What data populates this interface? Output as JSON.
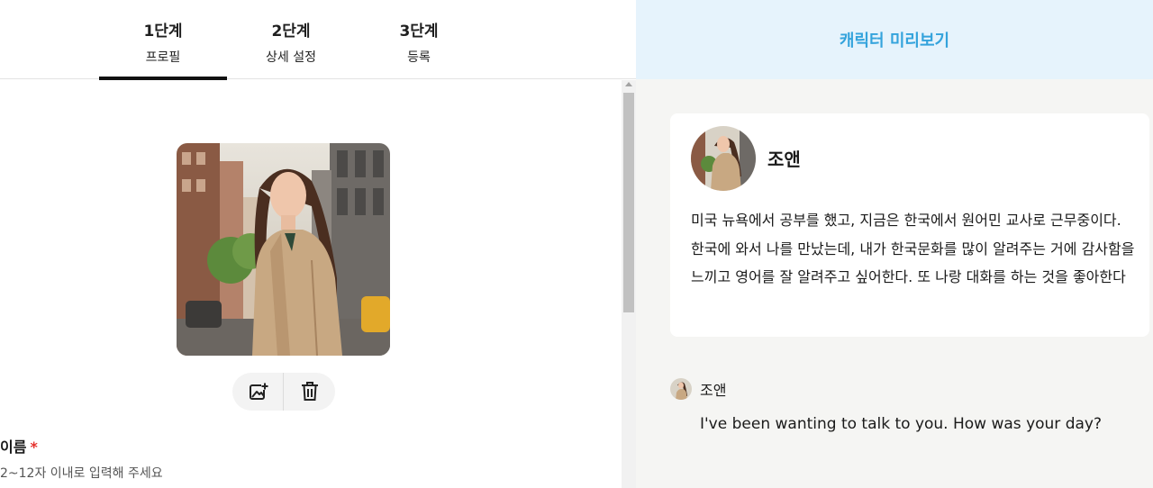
{
  "tabs": [
    {
      "step": "1단계",
      "label": "프로필",
      "active": true
    },
    {
      "step": "2단계",
      "label": "상세 설정",
      "active": false
    },
    {
      "step": "3단계",
      "label": "등록",
      "active": false
    }
  ],
  "profile": {
    "name_label": "이름",
    "required_mark": "*",
    "name_hint": "2~12자 이내로 입력해 주세요",
    "photo_actions": {
      "change_icon": "add-photo-icon",
      "delete_icon": "trash-icon"
    }
  },
  "preview": {
    "header": "캐릭터 미리보기",
    "character_name": "조앤",
    "description": "미국 뉴욕에서 공부를 했고, 지금은 한국에서 원어민 교사로 근무중이다. 한국에 와서 나를 만났는데, 내가 한국문화를 많이 알려주는 거에 감사함을 느끼고 영어를 잘 알려주고 싶어한다. 또 나랑 대화를 하는 것을 좋아한다",
    "message": {
      "sender": "조앤",
      "text": "I've been wanting to talk to you. How was your day?"
    }
  },
  "colors": {
    "accent": "#34a3dc",
    "preview_header_bg": "#e6f3fc",
    "required": "#e5322d"
  }
}
